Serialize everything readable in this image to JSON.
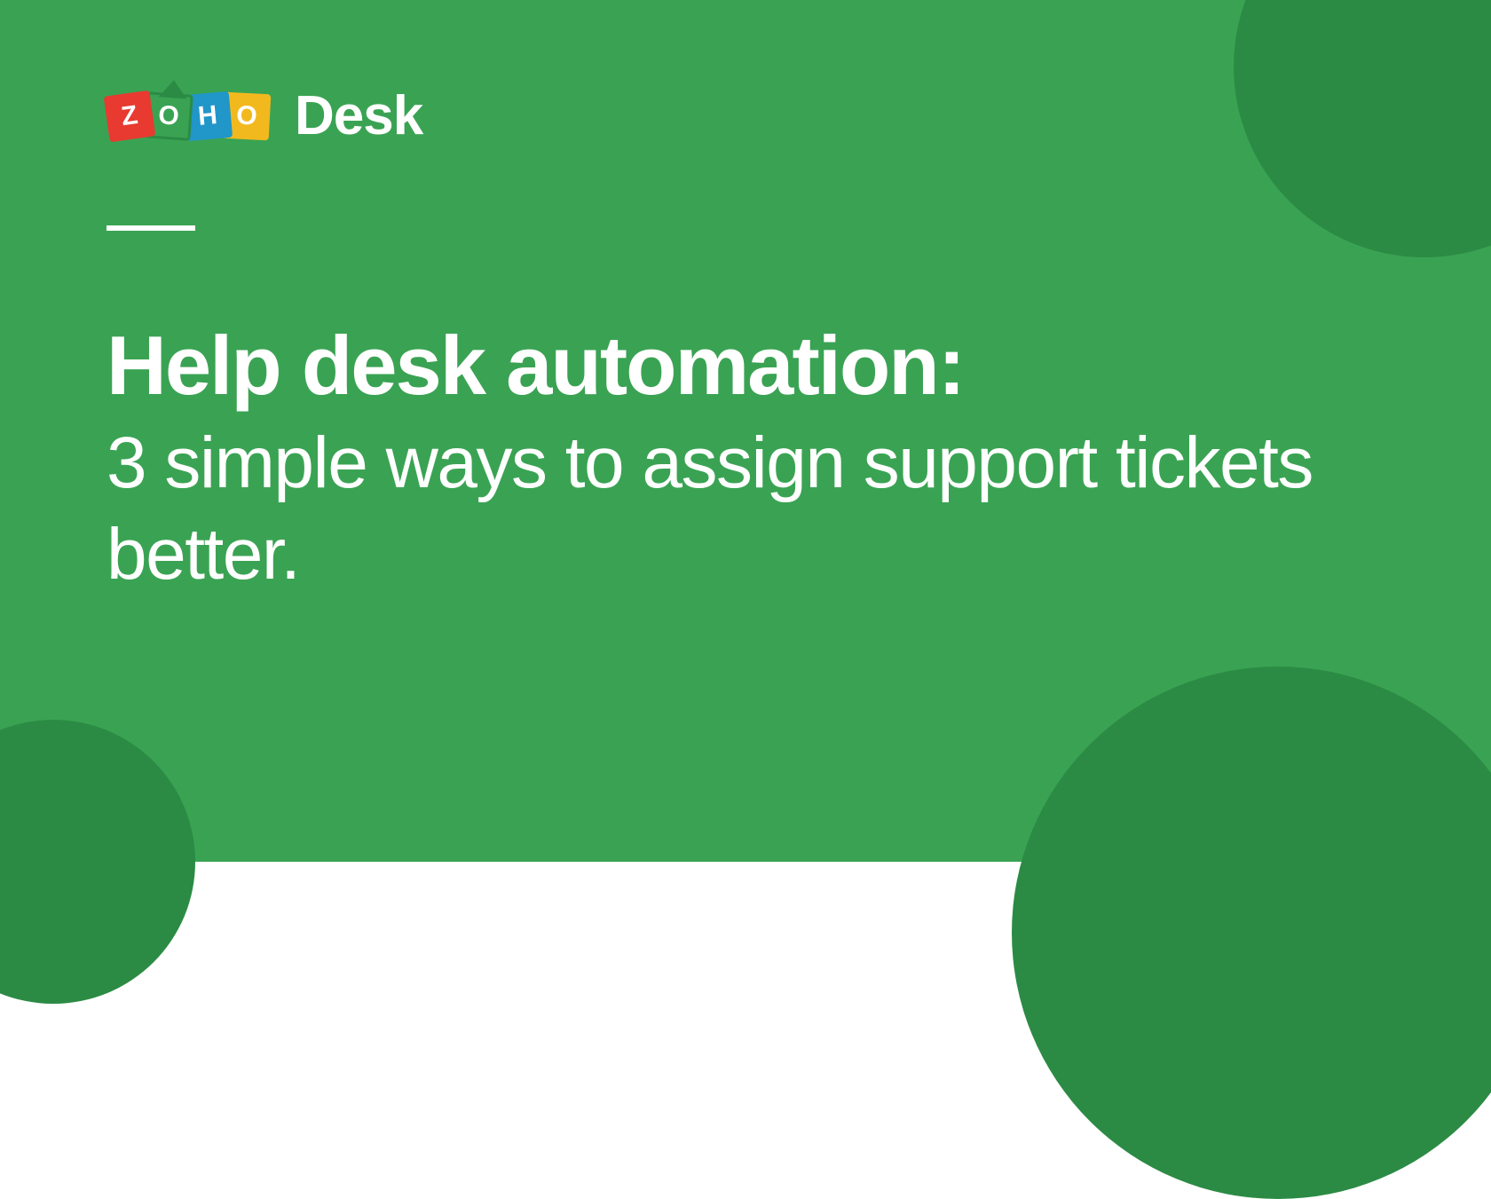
{
  "logo": {
    "letters": {
      "z": "Z",
      "o1": "O",
      "h": "H",
      "o2": "O"
    },
    "product": "Desk"
  },
  "headline": {
    "title": "Help desk automation:",
    "subtitle": "3 simple ways to assign support tickets better."
  },
  "colors": {
    "background": "#3aa353",
    "circles": "#2b8b44",
    "text": "#ffffff"
  }
}
